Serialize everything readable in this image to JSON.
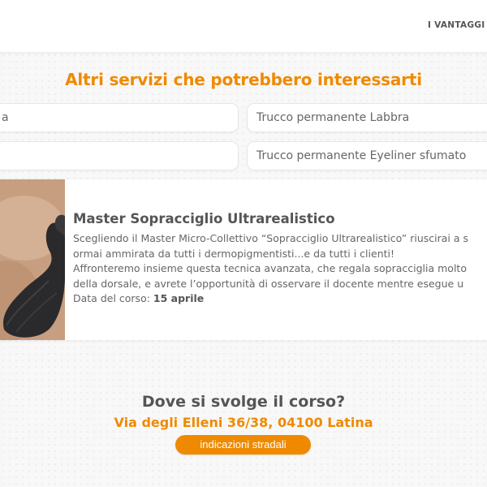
{
  "nav": {
    "vantaggi_label": "I VANTAGGI"
  },
  "services": {
    "title": "Altri servizi che potrebbero interessarti",
    "items": [
      {
        "label": "a"
      },
      {
        "label": "Trucco permanente Labbra"
      },
      {
        "label": ""
      },
      {
        "label": "Trucco permanente Eyeliner sfumato"
      }
    ]
  },
  "course": {
    "title": "Master Sopracciglio Ultrarealistico",
    "description_lines": [
      "Scegliendo il Master Micro-Collettivo “Sopracciglio Ultrarealistico” riuscirai a s",
      "ormai ammirata da tutti i dermopigmentisti...e da tutti i clienti!",
      "Affronteremo insieme questa tecnica avanzata, che regala sopracciglia molto",
      "della dorsale, e avrete l’opportunità di osservare il docente mentre esegue u"
    ],
    "date_label": "Data del corso:",
    "date_value": "15 aprile"
  },
  "location": {
    "title": "Dove si svolge il corso?",
    "address": "Via degli Elleni 36/38, 04100 Latina",
    "directions_label": "indicazioni stradali"
  },
  "colors": {
    "accent": "#ef8a00",
    "text": "#555555",
    "background": "#f8f8f8"
  }
}
